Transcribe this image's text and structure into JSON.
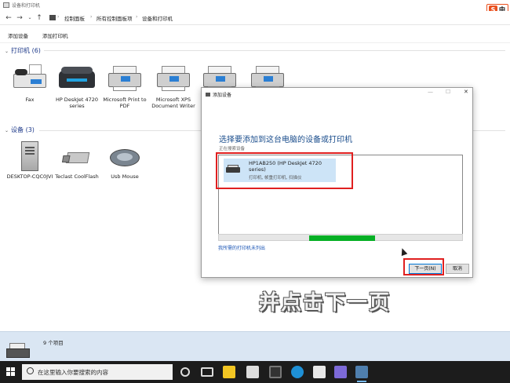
{
  "window": {
    "title": "设备和打印机"
  },
  "breadcrumb": [
    "控制面板",
    "所有控制面板项",
    "设备和打印机"
  ],
  "toolbar": {
    "add_device": "添加设备",
    "add_printer": "添加打印机"
  },
  "printers_section": {
    "label": "打印机 (6)"
  },
  "printers": [
    {
      "name": "Fax",
      "icon": "fax-icon"
    },
    {
      "name": "HP DeskJet 4720 series",
      "icon": "printer-icon"
    },
    {
      "name": "Microsoft Print to PDF",
      "icon": "printer-icon"
    },
    {
      "name": "Microsoft XPS Document Writer",
      "icon": "printer-icon"
    },
    {
      "name": "",
      "icon": "printer-icon"
    },
    {
      "name": "",
      "icon": "printer-icon"
    }
  ],
  "devices_section": {
    "label": "设备 (3)"
  },
  "devices": [
    {
      "name": "DESKTOP-CQC0JVI",
      "icon": "computer-icon"
    },
    {
      "name": "Teclast CoolFlash",
      "icon": "usb-drive-icon"
    },
    {
      "name": "Usb Mouse",
      "icon": "mouse-icon"
    }
  ],
  "status": {
    "item_count": "9 个项目"
  },
  "dialog": {
    "title": "添加设备",
    "heading": "选择要添加到这台电脑的设备或打印机",
    "subheading": "正在搜索设备",
    "found": {
      "name": "HP1AB250 (HP DeskJet 4720 series)",
      "description": "打印机, 帧重打印机, 扫描仪"
    },
    "progress": 0.27,
    "link": "我所需的打印机未列出",
    "next": "下一页(N)",
    "cancel": "取消"
  },
  "caption": "并点击下一页",
  "ime": {
    "label": "中"
  },
  "taskbar": {
    "search_placeholder": "在这里输入你要搜索的内容"
  },
  "colors": {
    "accent": "#0078d7",
    "highlight": "#e02020",
    "progress": "#06b025",
    "taskbar": "#1c1c1c"
  }
}
